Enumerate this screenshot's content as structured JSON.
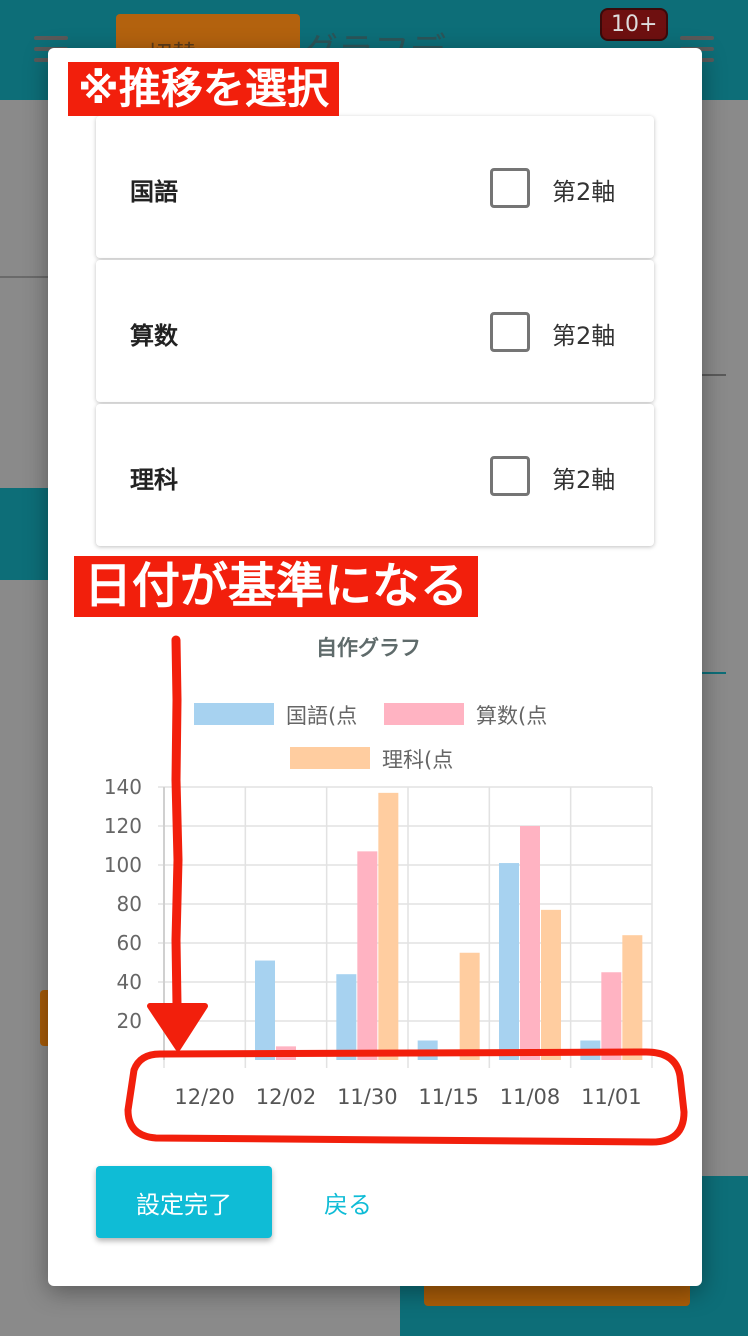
{
  "background": {
    "switch_label": "切替",
    "title": "グラフデ",
    "badge": "10+"
  },
  "annotations": {
    "select_trend": "※推移を選択",
    "date_basis": "日付が基準になる"
  },
  "subjects": [
    {
      "name": "国語",
      "axis_label": "第2軸",
      "checked": false
    },
    {
      "name": "算数",
      "axis_label": "第2軸",
      "checked": false
    },
    {
      "name": "理科",
      "axis_label": "第2軸",
      "checked": false
    }
  ],
  "buttons": {
    "done": "設定完了",
    "back": "戻る"
  },
  "colors": {
    "accent": "#0fbcd6",
    "annotation_red": "#f21f0c",
    "header_teal": "#0d6e78"
  },
  "chart_data": {
    "type": "bar",
    "title": "自作グラフ",
    "categories": [
      "12/20",
      "12/02",
      "11/30",
      "11/15",
      "11/08",
      "11/01"
    ],
    "series": [
      {
        "name": "国語(点",
        "color": "#a7d2f0",
        "values": [
          0,
          51,
          44,
          10,
          101,
          10
        ]
      },
      {
        "name": "算数(点",
        "color": "#ffb3c2",
        "values": [
          0,
          7,
          107,
          0,
          120,
          45
        ]
      },
      {
        "name": "理科(点",
        "color": "#ffcda0",
        "values": [
          0,
          0,
          137,
          55,
          77,
          64
        ]
      }
    ],
    "yticks": [
      20,
      40,
      60,
      80,
      100,
      120,
      140
    ],
    "ylim": [
      0,
      140
    ],
    "grid": true,
    "legend_position": "top"
  }
}
